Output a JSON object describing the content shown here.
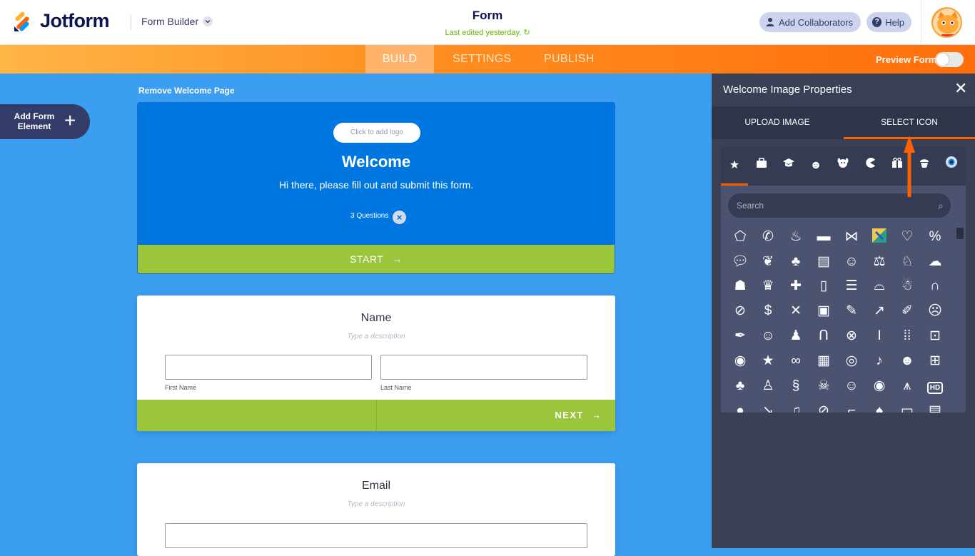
{
  "header": {
    "brand": "Jotform",
    "builder_label": "Form Builder",
    "form_title": "Form",
    "last_edited": "Last edited yesterday.",
    "add_collaborators": "Add Collaborators",
    "help": "Help"
  },
  "nav": {
    "tabs": [
      "BUILD",
      "SETTINGS",
      "PUBLISH"
    ],
    "active": "BUILD",
    "preview_label": "Preview Form",
    "preview_on": false
  },
  "left": {
    "add_element_label": "Add Form Element"
  },
  "canvas": {
    "remove_welcome": "Remove Welcome Page",
    "welcome": {
      "logo_placeholder": "Click to add logo",
      "title": "Welcome",
      "subtitle": "Hi there, please fill out and submit this form.",
      "questions": "3 Questions",
      "start": "START"
    },
    "name_card": {
      "title": "Name",
      "description": "Type a description",
      "first_label": "First Name",
      "last_label": "Last Name",
      "next": "NEXT"
    },
    "email_card": {
      "title": "Email",
      "description": "Type a description"
    }
  },
  "panel": {
    "title": "Welcome Image Properties",
    "tabs": [
      "UPLOAD IMAGE",
      "SELECT ICON"
    ],
    "active_tab": "SELECT ICON",
    "search_placeholder": "Search",
    "categories": [
      "star",
      "briefcase",
      "graduation-cap",
      "smiley",
      "dog",
      "pacman",
      "gift",
      "cupcake",
      "eye"
    ]
  },
  "colors": {
    "accent": "#ff6100",
    "canvas_bg": "#3c9ef0",
    "welcome_bg": "#0077e0",
    "green": "#9bc63b",
    "panel_bg": "#3a4157"
  }
}
